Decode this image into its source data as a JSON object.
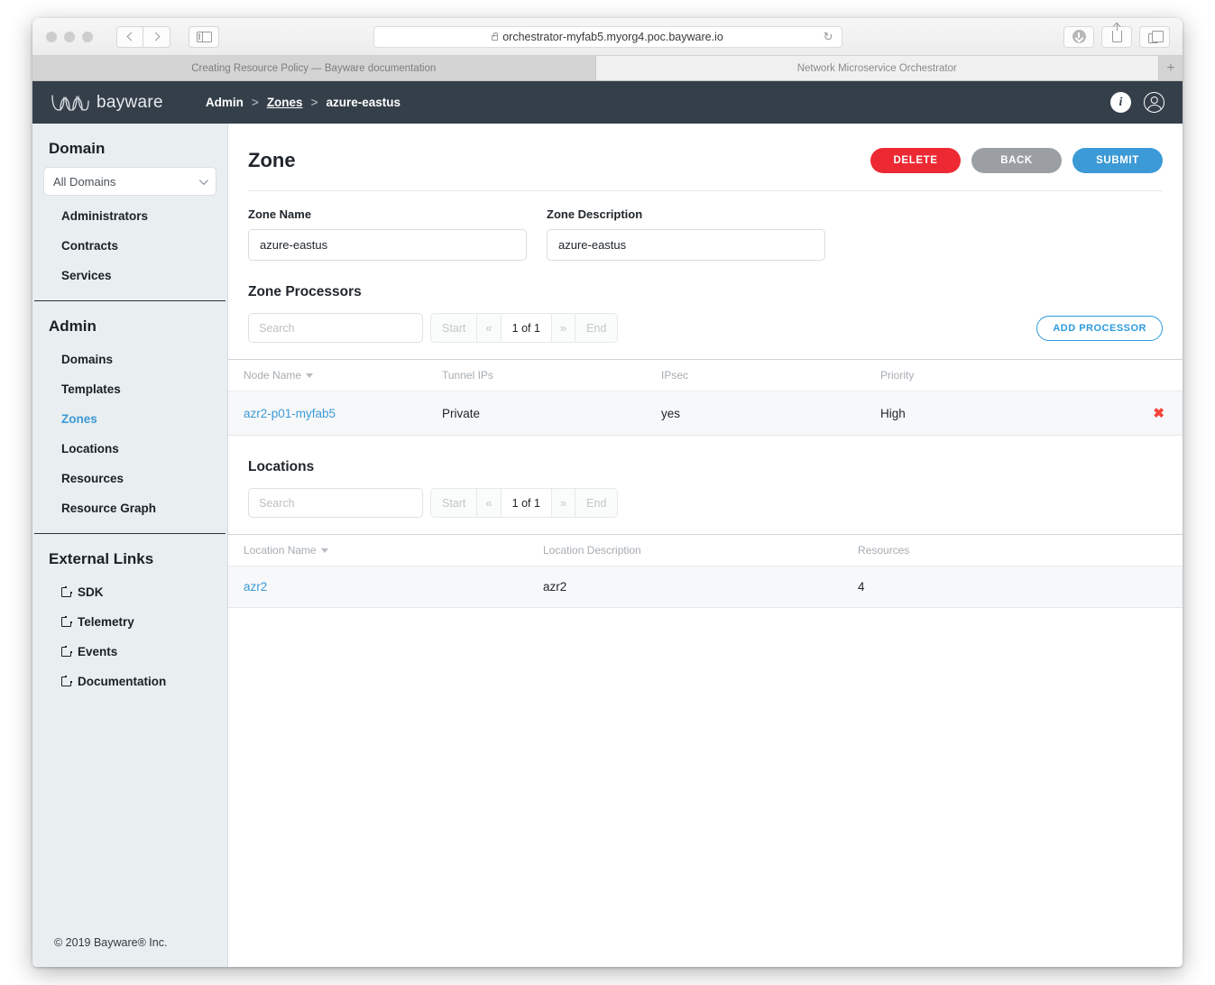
{
  "browser": {
    "url": "orchestrator-myfab5.myorg4.poc.bayware.io",
    "reload_glyph": "↻",
    "newtab_glyph": "+",
    "tabs": [
      {
        "label": "Creating Resource Policy — Bayware documentation",
        "active": false
      },
      {
        "label": "Network Microservice Orchestrator",
        "active": true
      }
    ]
  },
  "app_header": {
    "logo_text": "bayware",
    "breadcrumb": [
      {
        "label": "Admin",
        "link": false
      },
      {
        "label": "Zones",
        "link": true
      },
      {
        "label": "azure-eastus",
        "link": false
      }
    ],
    "separator": ">",
    "info_glyph": "i"
  },
  "sidebar": {
    "domain_title": "Domain",
    "domain_select_value": "All Domains",
    "domain_items": [
      {
        "label": "Administrators",
        "active": false
      },
      {
        "label": "Contracts",
        "active": false
      },
      {
        "label": "Services",
        "active": false
      }
    ],
    "admin_title": "Admin",
    "admin_items": [
      {
        "label": "Domains",
        "active": false
      },
      {
        "label": "Templates",
        "active": false
      },
      {
        "label": "Zones",
        "active": true
      },
      {
        "label": "Locations",
        "active": false
      },
      {
        "label": "Resources",
        "active": false
      },
      {
        "label": "Resource Graph",
        "active": false
      }
    ],
    "external_title": "External Links",
    "external_items": [
      {
        "label": "SDK"
      },
      {
        "label": "Telemetry"
      },
      {
        "label": "Events"
      },
      {
        "label": "Documentation"
      }
    ],
    "footer": "© 2019 Bayware® Inc."
  },
  "main": {
    "page_title": "Zone",
    "buttons": {
      "delete": "DELETE",
      "back": "BACK",
      "submit": "SUBMIT"
    },
    "form": {
      "zone_name_label": "Zone Name",
      "zone_name_value": "azure-eastus",
      "zone_name_placeholder": "",
      "zone_description_label": "Zone Description",
      "zone_description_value": "azure-eastus",
      "zone_description_placeholder": ""
    },
    "processors": {
      "title": "Zone Processors",
      "search_placeholder": "Search",
      "search_value": "",
      "pager": {
        "start": "Start",
        "prev": "«",
        "current": "1 of 1",
        "next": "»",
        "end": "End"
      },
      "add_button": "ADD PROCESSOR",
      "columns": [
        "Node Name",
        "Tunnel IPs",
        "IPsec",
        "Priority"
      ],
      "rows": [
        {
          "node_name": "azr2-p01-myfab5",
          "tunnel_ips": "Private",
          "ipsec": "yes",
          "priority": "High",
          "delete_glyph": "✖"
        }
      ]
    },
    "locations": {
      "title": "Locations",
      "search_placeholder": "Search",
      "search_value": "",
      "pager": {
        "start": "Start",
        "prev": "«",
        "current": "1 of 1",
        "next": "»",
        "end": "End"
      },
      "columns": [
        "Location Name",
        "Location Description",
        "Resources"
      ],
      "rows": [
        {
          "location_name": "azr2",
          "location_description": "azr2",
          "resources": "4"
        }
      ]
    }
  },
  "colors": {
    "header_bg": "#343f4a",
    "sidebar_bg": "#e9eef1",
    "accent_blue": "#3c9ad6",
    "delete_red": "#ed2a33",
    "back_gray": "#9b9fa4",
    "row_x_red": "#f4463c"
  }
}
